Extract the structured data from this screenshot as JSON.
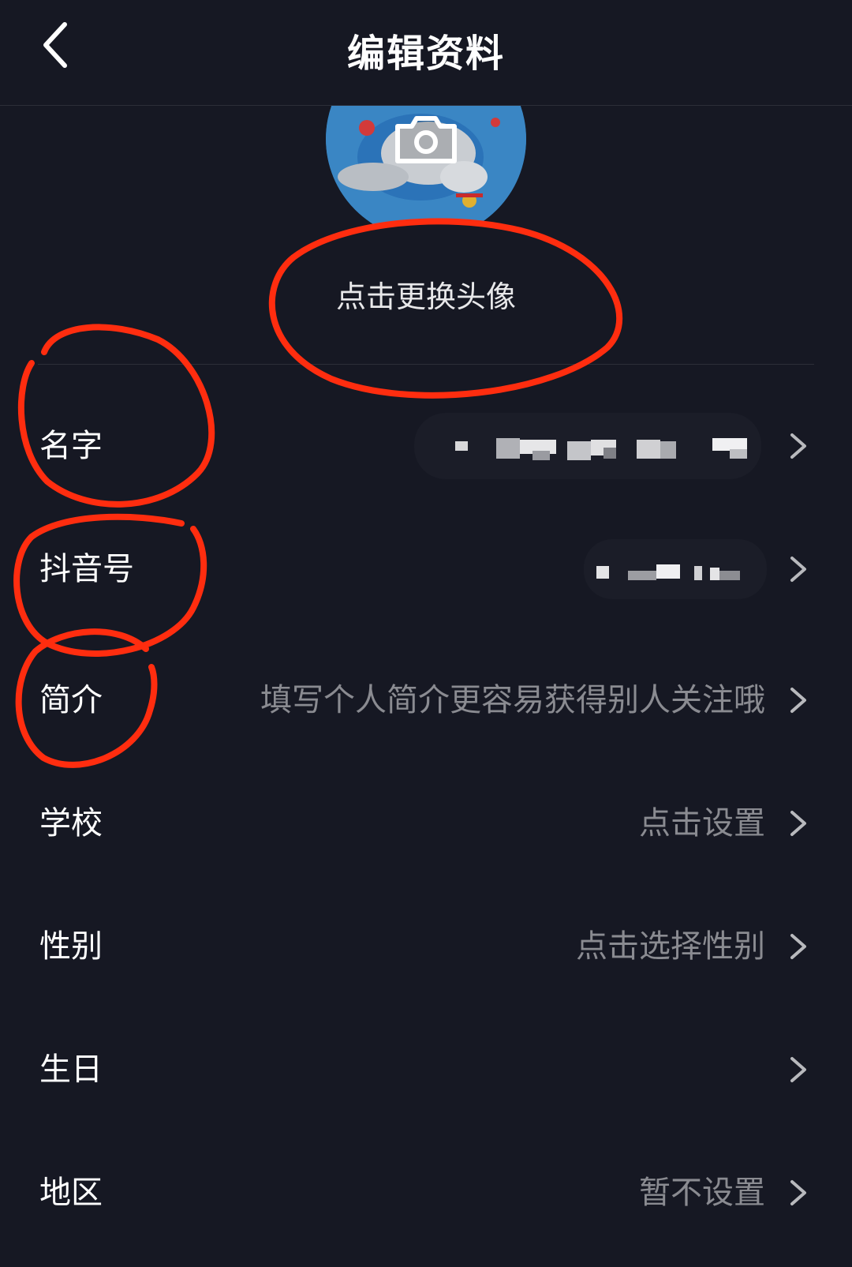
{
  "header": {
    "title": "编辑资料",
    "back_icon": "chevron-left-icon"
  },
  "avatar": {
    "change_label": "点击更换头像",
    "camera_icon": "camera-icon"
  },
  "fields": [
    {
      "label": "名字",
      "value": "",
      "value_obscured": true
    },
    {
      "label": "抖音号",
      "value": "",
      "value_obscured": true
    },
    {
      "label": "简介",
      "value": "填写个人简介更容易获得别人关注哦"
    },
    {
      "label": "学校",
      "value": "点击设置"
    },
    {
      "label": "性别",
      "value": "点击选择性别"
    },
    {
      "label": "生日",
      "value": ""
    },
    {
      "label": "地区",
      "value": "暂不设置"
    }
  ],
  "colors": {
    "background": "#161823",
    "annotation": "#ff2d0f",
    "secondary_text": "#8a8b91"
  }
}
